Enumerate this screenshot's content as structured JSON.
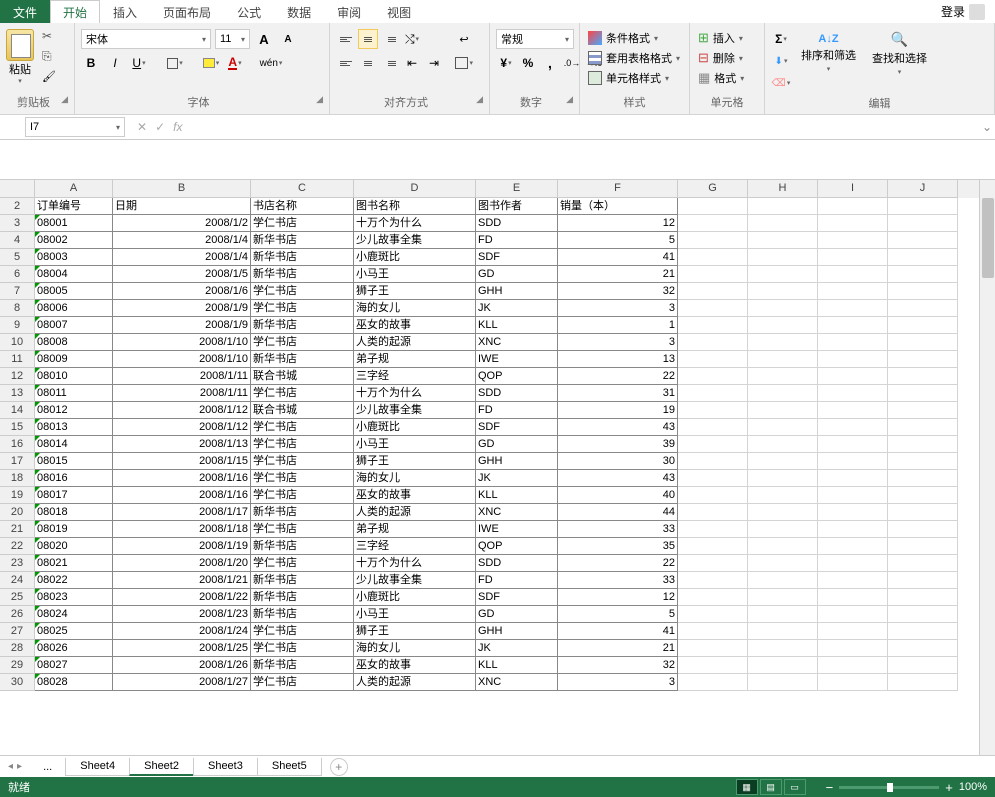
{
  "titlebar": {
    "tabs": [
      "文件",
      "开始",
      "插入",
      "页面布局",
      "公式",
      "数据",
      "审阅",
      "视图"
    ],
    "active": 1,
    "login": "登录"
  },
  "ribbon": {
    "clipboard": {
      "label": "剪贴板",
      "paste": "粘贴"
    },
    "font": {
      "label": "字体",
      "name": "宋体",
      "size": "11",
      "bold": "B",
      "italic": "I",
      "underline": "U",
      "wen": "wén"
    },
    "align": {
      "label": "对齐方式"
    },
    "number": {
      "label": "数字",
      "format": "常规"
    },
    "styles": {
      "label": "样式",
      "cf": "条件格式",
      "table": "套用表格格式",
      "cell": "单元格样式"
    },
    "cells": {
      "label": "单元格",
      "insert": "插入",
      "delete": "删除",
      "format": "格式"
    },
    "editing": {
      "label": "编辑",
      "sort": "排序和筛选",
      "find": "查找和选择"
    }
  },
  "namebox": {
    "ref": "I7",
    "fx": "fx"
  },
  "columns": [
    {
      "l": "A",
      "w": 78
    },
    {
      "l": "B",
      "w": 138
    },
    {
      "l": "C",
      "w": 103
    },
    {
      "l": "D",
      "w": 122
    },
    {
      "l": "E",
      "w": 82
    },
    {
      "l": "F",
      "w": 120
    },
    {
      "l": "G",
      "w": 70
    },
    {
      "l": "H",
      "w": 70
    },
    {
      "l": "I",
      "w": 70
    },
    {
      "l": "J",
      "w": 70
    }
  ],
  "header_row": {
    "n": 2,
    "cells": [
      "订单编号",
      "日期",
      "书店名称",
      "图书名称",
      "图书作者",
      "销量（本）"
    ]
  },
  "data_rows": [
    {
      "n": 3,
      "id": "08001",
      "date": "2008/1/2",
      "store": "学仁书店",
      "book": "十万个为什么",
      "author": "SDD",
      "qty": "12"
    },
    {
      "n": 4,
      "id": "08002",
      "date": "2008/1/4",
      "store": "新华书店",
      "book": "少儿故事全集",
      "author": "FD",
      "qty": "5"
    },
    {
      "n": 5,
      "id": "08003",
      "date": "2008/1/4",
      "store": "新华书店",
      "book": "小鹿斑比",
      "author": "SDF",
      "qty": "41"
    },
    {
      "n": 6,
      "id": "08004",
      "date": "2008/1/5",
      "store": "新华书店",
      "book": "小马王",
      "author": "GD",
      "qty": "21"
    },
    {
      "n": 7,
      "id": "08005",
      "date": "2008/1/6",
      "store": "学仁书店",
      "book": "狮子王",
      "author": "GHH",
      "qty": "32"
    },
    {
      "n": 8,
      "id": "08006",
      "date": "2008/1/9",
      "store": "学仁书店",
      "book": "海的女儿",
      "author": "JK",
      "qty": "3"
    },
    {
      "n": 9,
      "id": "08007",
      "date": "2008/1/9",
      "store": "新华书店",
      "book": "巫女的故事",
      "author": "KLL",
      "qty": "1"
    },
    {
      "n": 10,
      "id": "08008",
      "date": "2008/1/10",
      "store": "学仁书店",
      "book": "人类的起源",
      "author": "XNC",
      "qty": "3"
    },
    {
      "n": 11,
      "id": "08009",
      "date": "2008/1/10",
      "store": "新华书店",
      "book": "弟子规",
      "author": "IWE",
      "qty": "13"
    },
    {
      "n": 12,
      "id": "08010",
      "date": "2008/1/11",
      "store": "联合书城",
      "book": "三字经",
      "author": "QOP",
      "qty": "22"
    },
    {
      "n": 13,
      "id": "08011",
      "date": "2008/1/11",
      "store": "学仁书店",
      "book": "十万个为什么",
      "author": "SDD",
      "qty": "31"
    },
    {
      "n": 14,
      "id": "08012",
      "date": "2008/1/12",
      "store": "联合书城",
      "book": "少儿故事全集",
      "author": "FD",
      "qty": "19"
    },
    {
      "n": 15,
      "id": "08013",
      "date": "2008/1/12",
      "store": "学仁书店",
      "book": "小鹿斑比",
      "author": "SDF",
      "qty": "43"
    },
    {
      "n": 16,
      "id": "08014",
      "date": "2008/1/13",
      "store": "学仁书店",
      "book": "小马王",
      "author": "GD",
      "qty": "39"
    },
    {
      "n": 17,
      "id": "08015",
      "date": "2008/1/15",
      "store": "学仁书店",
      "book": "狮子王",
      "author": "GHH",
      "qty": "30"
    },
    {
      "n": 18,
      "id": "08016",
      "date": "2008/1/16",
      "store": "学仁书店",
      "book": "海的女儿",
      "author": "JK",
      "qty": "43"
    },
    {
      "n": 19,
      "id": "08017",
      "date": "2008/1/16",
      "store": "学仁书店",
      "book": "巫女的故事",
      "author": "KLL",
      "qty": "40"
    },
    {
      "n": 20,
      "id": "08018",
      "date": "2008/1/17",
      "store": "新华书店",
      "book": "人类的起源",
      "author": "XNC",
      "qty": "44"
    },
    {
      "n": 21,
      "id": "08019",
      "date": "2008/1/18",
      "store": "学仁书店",
      "book": "弟子规",
      "author": "IWE",
      "qty": "33"
    },
    {
      "n": 22,
      "id": "08020",
      "date": "2008/1/19",
      "store": "新华书店",
      "book": "三字经",
      "author": "QOP",
      "qty": "35"
    },
    {
      "n": 23,
      "id": "08021",
      "date": "2008/1/20",
      "store": "学仁书店",
      "book": "十万个为什么",
      "author": "SDD",
      "qty": "22"
    },
    {
      "n": 24,
      "id": "08022",
      "date": "2008/1/21",
      "store": "新华书店",
      "book": "少儿故事全集",
      "author": "FD",
      "qty": "33"
    },
    {
      "n": 25,
      "id": "08023",
      "date": "2008/1/22",
      "store": "新华书店",
      "book": "小鹿斑比",
      "author": "SDF",
      "qty": "12"
    },
    {
      "n": 26,
      "id": "08024",
      "date": "2008/1/23",
      "store": "新华书店",
      "book": "小马王",
      "author": "GD",
      "qty": "5"
    },
    {
      "n": 27,
      "id": "08025",
      "date": "2008/1/24",
      "store": "学仁书店",
      "book": "狮子王",
      "author": "GHH",
      "qty": "41"
    },
    {
      "n": 28,
      "id": "08026",
      "date": "2008/1/25",
      "store": "学仁书店",
      "book": "海的女儿",
      "author": "JK",
      "qty": "21"
    },
    {
      "n": 29,
      "id": "08027",
      "date": "2008/1/26",
      "store": "新华书店",
      "book": "巫女的故事",
      "author": "KLL",
      "qty": "32"
    },
    {
      "n": 30,
      "id": "08028",
      "date": "2008/1/27",
      "store": "学仁书店",
      "book": "人类的起源",
      "author": "XNC",
      "qty": "3"
    }
  ],
  "sheets": {
    "list": [
      "Sheet4",
      "Sheet2",
      "Sheet3",
      "Sheet5"
    ],
    "active": 1,
    "dots": "..."
  },
  "statusbar": {
    "ready": "就绪",
    "zoom": "100%"
  }
}
